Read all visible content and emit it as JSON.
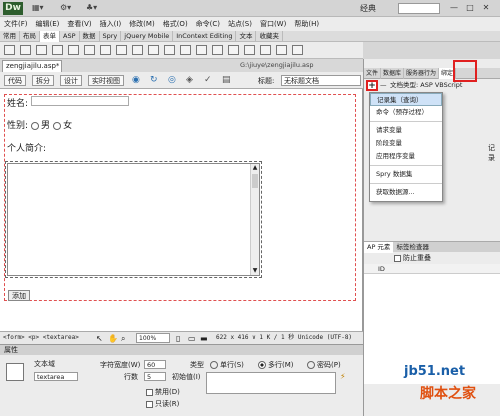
{
  "app": {
    "logo": "Dw",
    "workspace": "经典",
    "window_buttons": [
      "—",
      "□",
      "✕"
    ]
  },
  "menu": [
    "文件(F)",
    "编辑(E)",
    "查看(V)",
    "插入(I)",
    "修改(M)",
    "格式(O)",
    "命令(C)",
    "站点(S)",
    "窗口(W)",
    "帮助(H)"
  ],
  "insert_tabs": [
    "常用",
    "布局",
    "表单",
    "ASP",
    "数据",
    "Spry",
    "jQuery Mobile",
    "InContext Editing",
    "文本",
    "收藏夹"
  ],
  "insert_active": 2,
  "document": {
    "tab": "zengjiajilu.asp*",
    "path": "G:\\jiuye\\zengjiajilu.asp",
    "views": [
      "代码",
      "拆分",
      "设计",
      "实时视图"
    ],
    "title_label": "标题:",
    "title_value": "无标题文档"
  },
  "form": {
    "name_label": "姓名:",
    "gender_label": "性别:",
    "male": "男",
    "female": "女",
    "intro_label": "个人简介:",
    "add_button": "添加"
  },
  "status": {
    "tagpath": "<form> <p> <textarea>",
    "zoom": "100%",
    "info": "622 x 416 ∨ 1 K / 1 秒 Unicode (UTF-8)"
  },
  "properties": {
    "title": "属性",
    "type_name": "文本域",
    "name_value": "textarea",
    "char_width_label": "字符宽度(W)",
    "char_width": "60",
    "rows_label": "行数",
    "rows": "5",
    "init_label": "初始值(I)",
    "type_label": "类型",
    "single": "单行(S)",
    "multi": "多行(M)",
    "password": "密码(P)",
    "disabled": "禁用(D)",
    "readonly": "只读(R)"
  },
  "right_panel": {
    "tabs": [
      "文件",
      "数据库",
      "服务器行为",
      "绑定"
    ],
    "active": 3,
    "plus": "+",
    "dash": "—",
    "doctype": "文档类型: ASP VBScript",
    "side_text1": "记",
    "side_text2": "录",
    "menu": [
      "记录集（查询）",
      "命令（预存过程）",
      "",
      "请求变量",
      "阶段变量",
      "应用程序变量",
      "",
      "Spry 数据集",
      "",
      "获取数据源..."
    ],
    "ap_tabs": [
      "AP 元素",
      "标签检查器"
    ],
    "ap_checkbox": "防止重叠",
    "ap_col": "ID"
  },
  "watermark": {
    "line1": "jb51.net",
    "line2": "脚本之家"
  }
}
